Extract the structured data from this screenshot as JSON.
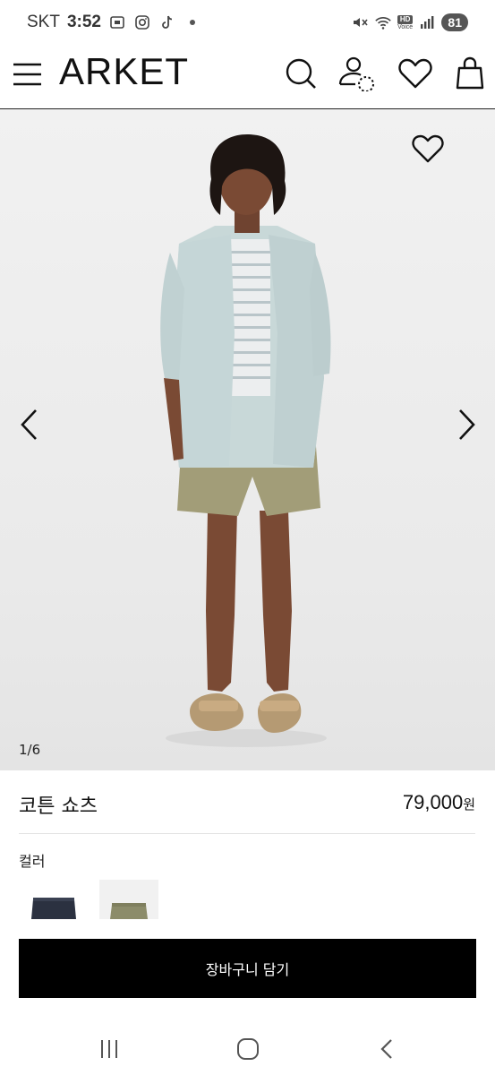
{
  "status_bar": {
    "carrier": "SKT",
    "time": "3:52",
    "battery": "81",
    "hd_label": "HD",
    "voice_label": "Voice"
  },
  "header": {
    "logo": "ARKET",
    "icons": [
      "menu-icon",
      "search-icon",
      "account-icon",
      "heart-icon",
      "shopping-bag-icon"
    ]
  },
  "gallery": {
    "counter": "1/6",
    "current_image": 1,
    "total_images": 6
  },
  "product": {
    "name": "코튼 쇼츠",
    "price": "79,000",
    "currency": "원",
    "color_label": "컬러",
    "swatches": [
      {
        "name": "navy",
        "color": "#2b3140"
      },
      {
        "name": "khaki",
        "color": "#8c8c6a",
        "selected": true
      }
    ]
  },
  "cta": {
    "add_to_cart": "장바구니 담기"
  },
  "colors": {
    "primary_button": "#000000",
    "background": "#ffffff"
  }
}
